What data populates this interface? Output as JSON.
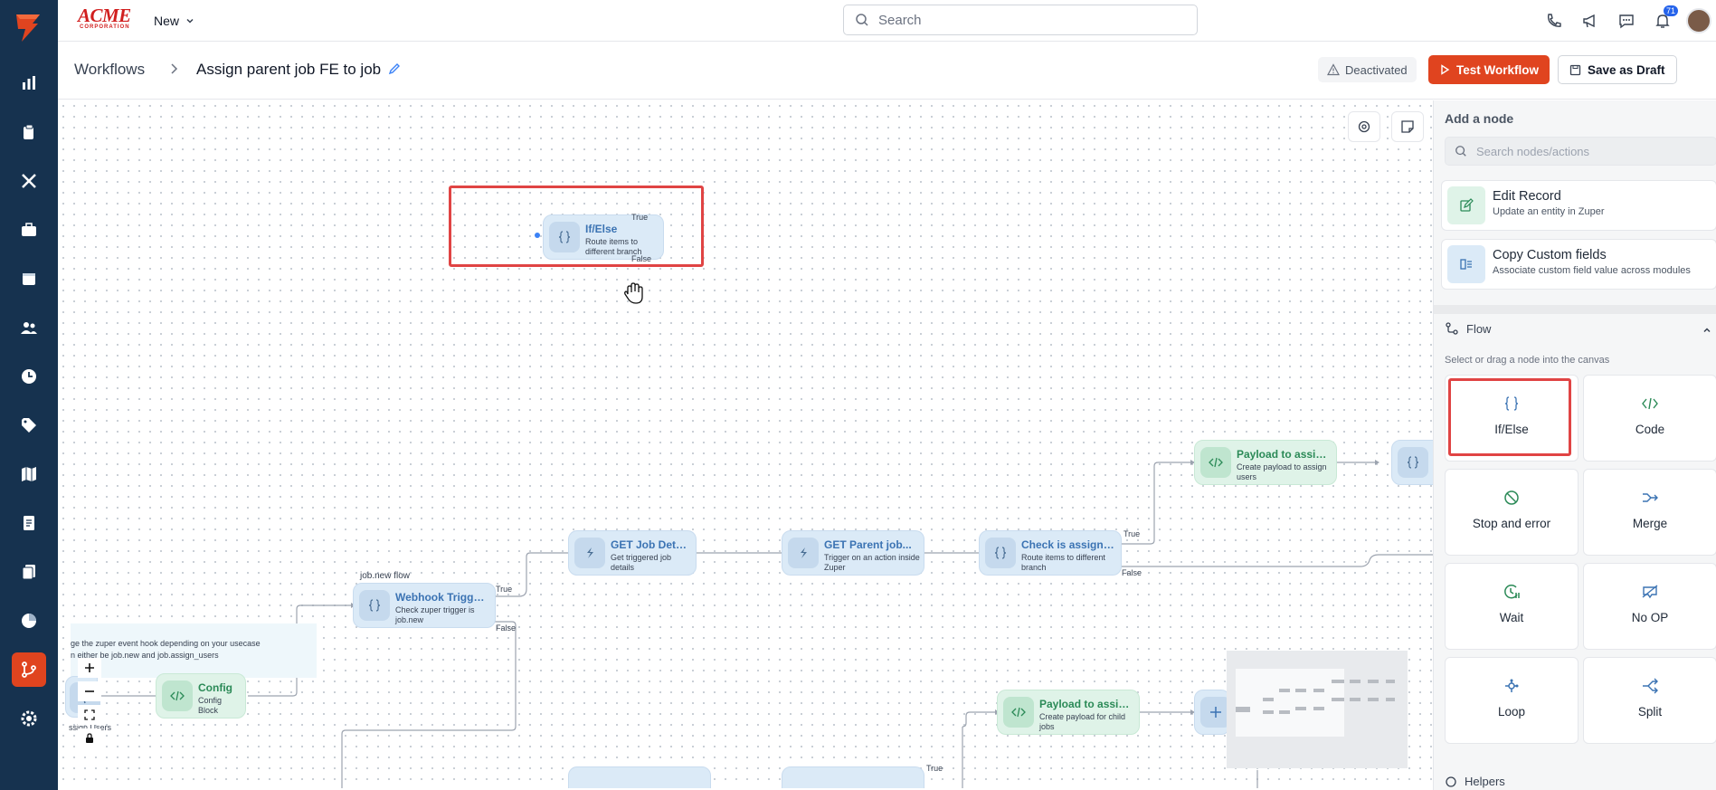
{
  "topbar": {
    "brand_name": "ACME",
    "brand_sub": "CORPORATION",
    "new_label": "New",
    "search_placeholder": "Search",
    "notification_count": "71"
  },
  "titlebar": {
    "breadcrumb_root": "Workflows",
    "workflow_name": "Assign parent job FE to job",
    "status_label": "Deactivated",
    "test_label": "Test Workflow",
    "draft_label": "Save as Draft"
  },
  "canvas": {
    "floating_node": {
      "title": "If/Else",
      "desc": "Route items to different branch",
      "true_label": "True",
      "false_label": "False"
    },
    "flow_tag": "job.new flow",
    "note_line1": "ge the zuper event hook depending on your usecase",
    "note_line2": "n either be job.new and job.assign_users",
    "note_line3": "ssign Users",
    "nodes": [
      {
        "title": "Config",
        "desc": "Config Block"
      },
      {
        "title": "Webhook Trigger...",
        "desc": "Check zuper trigger is job.new"
      },
      {
        "title": "GET Job Details",
        "desc": "Get triggered job details"
      },
      {
        "title": "GET Parent job...",
        "desc": "Trigger on an action inside Zuper"
      },
      {
        "title": "Check is assigned...",
        "desc": "Route items to different branch"
      },
      {
        "title": "Payload to assign...",
        "desc": "Create payload to assign users"
      },
      {
        "title": "Payload to assign...",
        "desc": "Create payload for child jobs"
      }
    ],
    "edge_labels": {
      "true": "True",
      "false": "False"
    }
  },
  "panel": {
    "title": "Add a node",
    "search_placeholder": "Search nodes/actions",
    "actions": [
      {
        "title": "Edit Record",
        "desc": "Update an entity in Zuper"
      },
      {
        "title": "Copy Custom fields",
        "desc": "Associate custom field value across modules"
      }
    ],
    "flow_header": "Flow",
    "flow_hint": "Select or drag a node into the canvas",
    "tiles": [
      {
        "label": "If/Else",
        "icon": "braces-icon"
      },
      {
        "label": "Code",
        "icon": "code-icon"
      },
      {
        "label": "Stop and error",
        "icon": "stop-icon"
      },
      {
        "label": "Merge",
        "icon": "merge-icon"
      },
      {
        "label": "Wait",
        "icon": "clock-icon"
      },
      {
        "label": "No OP",
        "icon": "no-op-icon"
      },
      {
        "label": "Loop",
        "icon": "loop-icon"
      },
      {
        "label": "Split",
        "icon": "split-icon"
      }
    ],
    "helpers_header": "Helpers"
  },
  "colors": {
    "rail": "#16324f",
    "accent": "#e0441f",
    "highlight": "#e04444",
    "node_blue": "#dbeaf7",
    "node_green": "#dff3e8"
  }
}
